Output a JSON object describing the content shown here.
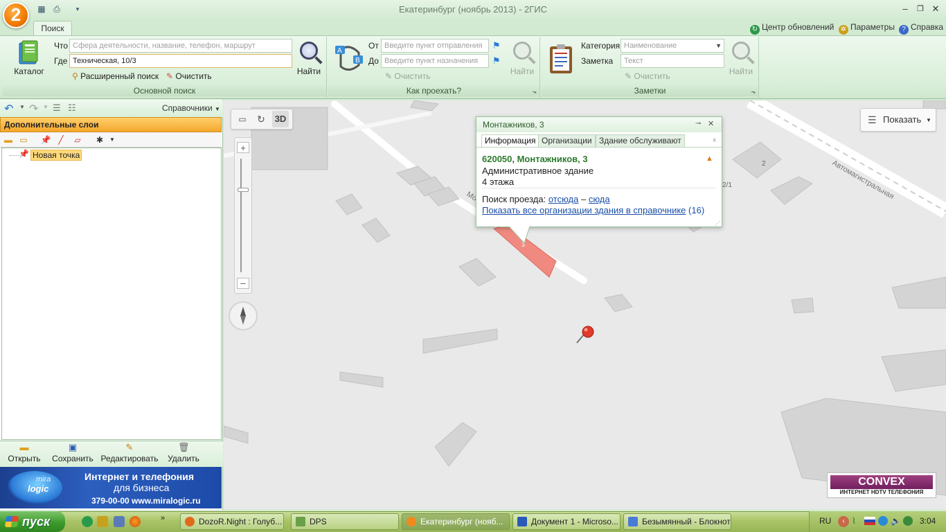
{
  "window": {
    "title": "Екатеринбург (ноябрь 2013) - 2ГИС",
    "logo": "2"
  },
  "quick_access": [
    "catalog-icon",
    "print-icon",
    "dropdown-icon"
  ],
  "tabs": [
    {
      "label": "Поиск",
      "active": true
    }
  ],
  "top_links": [
    {
      "label": "Центр обновлений",
      "icon": "refresh-icon"
    },
    {
      "label": "Параметры",
      "icon": "gear-icon"
    },
    {
      "label": "Справка",
      "icon": "help-icon"
    }
  ],
  "ribbon": {
    "main_search": {
      "group_label": "Основной поиск",
      "catalog_label": "Каталог",
      "what_label": "Что",
      "what_placeholder": "Сфера деятельности, название, телефон, маршрут",
      "where_label": "Где",
      "where_value": "Техническая, 10/3",
      "find_label": "Найти",
      "advanced_label": "Расширенный поиск",
      "clear_label": "Очистить"
    },
    "route": {
      "group_label": "Как проехать?",
      "from_label": "От",
      "from_placeholder": "Введите пункт отправления",
      "to_label": "До",
      "to_placeholder": "Введите пункт назначения",
      "find_label": "Найти",
      "clear_label": "Очистить"
    },
    "notes": {
      "group_label": "Заметки",
      "category_label": "Категория",
      "category_placeholder": "Наименование",
      "note_label": "Заметка",
      "note_placeholder": "Текст",
      "find_label": "Найти",
      "clear_label": "Очистить"
    }
  },
  "left_panel": {
    "directory_label": "Справочники",
    "layers_header": "Дополнительные слои",
    "tree_items": [
      {
        "label": "Новая точка"
      }
    ],
    "actions": [
      {
        "label": "Открыть",
        "icon": "folder-icon"
      },
      {
        "label": "Сохранить",
        "icon": "save-icon"
      },
      {
        "label": "Редактировать",
        "icon": "edit-icon"
      },
      {
        "label": "Удалить",
        "icon": "trash-icon"
      }
    ],
    "ad": {
      "brand_top": "mira",
      "brand_bottom": "logic",
      "line1": "Интернет и телефония",
      "line2": "для бизнеса",
      "line3": "379-00-00 www.miralogic.ru"
    }
  },
  "map": {
    "mode_3d_label": "3D",
    "show_button_label": "Показать",
    "street_label_1": "Автомагистральная",
    "street_label_2": "Мо",
    "building_labels": [
      "2",
      "2/1",
      "3"
    ],
    "convex_title": "CONVEX",
    "convex_subtitle": "ИНТЕРНЕТ HDTV ТЕЛЕФОНИЯ"
  },
  "popup": {
    "title": "Монтажников, 3",
    "tabs": [
      "Информация",
      "Организации",
      "Здание обслуживают"
    ],
    "address": "620050, Монтажников, 3",
    "building_type": "Административное здание",
    "floors": "4 этажа",
    "route_prefix": "Поиск проезда:",
    "route_from": "отсюда",
    "route_dash": "–",
    "route_to": "сюда",
    "show_all_link": "Показать все организации здания в справочнике",
    "show_all_count": "(16)"
  },
  "taskbar": {
    "start_label": "пуск",
    "tasks": [
      {
        "label": "DozoR.Night : Голуб...",
        "active": false,
        "color": "#e06a1a"
      },
      {
        "label": "DPS",
        "active": false,
        "color": "#6aa04a"
      },
      {
        "label": "Екатеринбург (нояб...",
        "active": true,
        "color": "#f08a1a"
      },
      {
        "label": "Документ 1 - Microso...",
        "active": false,
        "color": "#2a5ab8"
      },
      {
        "label": "Безымянный - Блокнот",
        "active": false,
        "color": "#4a7ad8"
      }
    ],
    "lang": "RU",
    "clock": "3:04"
  },
  "colors": {
    "ribbon_bg": "#d9efd9",
    "accent_orange": "#f3a72c",
    "link_blue": "#1a4fa8",
    "address_green": "#2d7a2d",
    "highlight_building": "#f08a80"
  }
}
